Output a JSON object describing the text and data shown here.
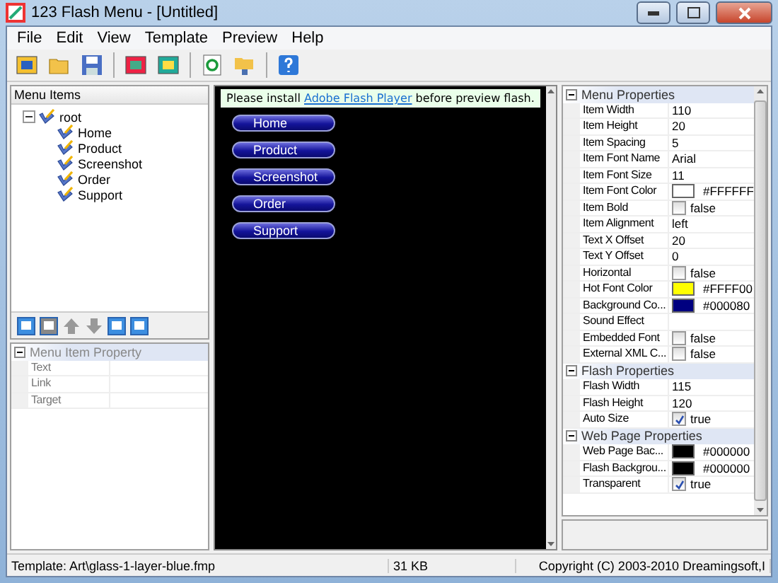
{
  "window": {
    "title": "123 Flash Menu - [Untitled]"
  },
  "menu": [
    "File",
    "Edit",
    "View",
    "Template",
    "Preview",
    "Help"
  ],
  "menu_items_panel": {
    "title": "Menu Items",
    "tree": {
      "label": "root",
      "expanded": true,
      "children": [
        {
          "label": "Home"
        },
        {
          "label": "Product"
        },
        {
          "label": "Screenshot"
        },
        {
          "label": "Order"
        },
        {
          "label": "Support"
        }
      ]
    }
  },
  "item_property": {
    "title": "Menu Item Property",
    "rows": [
      {
        "name": "Text"
      },
      {
        "name": "Link"
      },
      {
        "name": "Target"
      }
    ]
  },
  "preview": {
    "notice_before": "Please install ",
    "notice_link": "Adobe Flash Player",
    "notice_after": " before preview flash.",
    "buttons": [
      "Home",
      "Product",
      "Screenshot",
      "Order",
      "Support"
    ]
  },
  "properties": [
    {
      "title": "Menu Properties",
      "rows": [
        {
          "kind": "text",
          "name": "Item Width",
          "value": "110"
        },
        {
          "kind": "text",
          "name": "Item Height",
          "value": "20"
        },
        {
          "kind": "text",
          "name": "Item Spacing",
          "value": "5"
        },
        {
          "kind": "text",
          "name": "Item Font Name",
          "value": "Arial"
        },
        {
          "kind": "text",
          "name": "Item Font Size",
          "value": "11"
        },
        {
          "kind": "color",
          "name": "Item Font Color",
          "value": "#FFFFFF",
          "color": "#ffffff"
        },
        {
          "kind": "bool",
          "name": "Item Bold",
          "value": "false",
          "checked": false
        },
        {
          "kind": "text",
          "name": "Item Alignment",
          "value": "left"
        },
        {
          "kind": "text",
          "name": "Text X Offset",
          "value": "20"
        },
        {
          "kind": "text",
          "name": "Text Y Offset",
          "value": "0"
        },
        {
          "kind": "bool",
          "name": "Horizontal",
          "value": "false",
          "checked": false
        },
        {
          "kind": "color",
          "name": "Hot Font Color",
          "value": "#FFFF00",
          "color": "#ffff00"
        },
        {
          "kind": "color",
          "name": "Background Co...",
          "value": "#000080",
          "color": "#000080"
        },
        {
          "kind": "text",
          "name": "Sound Effect"
        },
        {
          "kind": "bool",
          "name": "Embedded Font",
          "value": "false",
          "checked": false
        },
        {
          "kind": "bool",
          "name": "External XML C...",
          "value": "false",
          "checked": false
        }
      ]
    },
    {
      "title": "Flash Properties",
      "rows": [
        {
          "kind": "text",
          "name": "Flash Width",
          "value": "115"
        },
        {
          "kind": "text",
          "name": "Flash Height",
          "value": "120"
        },
        {
          "kind": "bool",
          "name": "Auto Size",
          "value": "true",
          "checked": true
        }
      ]
    },
    {
      "title": "Web Page Properties",
      "rows": [
        {
          "kind": "color",
          "name": "Web Page Bac...",
          "value": "#000000",
          "color": "#000000"
        },
        {
          "kind": "color",
          "name": "Flash Backgrou...",
          "value": "#000000",
          "color": "#000000"
        },
        {
          "kind": "bool",
          "name": "Transparent",
          "value": "true",
          "checked": true
        }
      ]
    }
  ],
  "status_bar": [
    "Template:  Art\\glass-1-layer-blue.fmp",
    "31 KB",
    "Copyright (C) 2003-2010 Dreamingsoft,I"
  ]
}
